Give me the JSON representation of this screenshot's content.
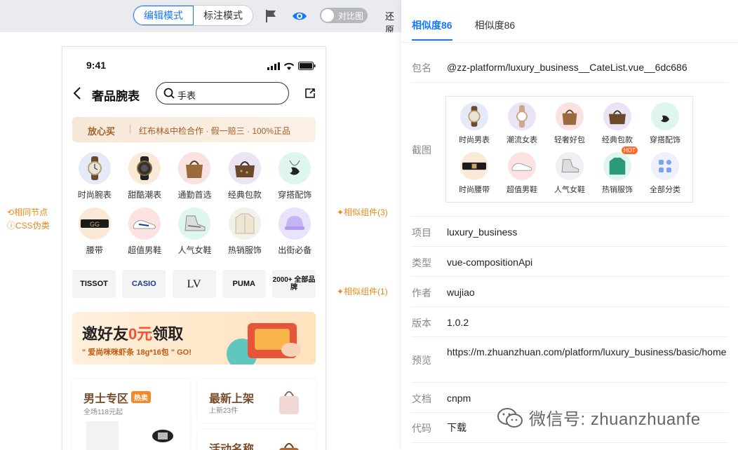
{
  "toolbar": {
    "mode_edit": "编辑模式",
    "mode_annotate": "标注模式",
    "compare_label": "对比图",
    "restore_label": "还原",
    "accent": "#1677ff"
  },
  "canvas": {
    "notes_left": {
      "same_node": "相同节点",
      "css_pseudo": "CSS伪类"
    },
    "notes_right": {
      "similar3": "相似组件(3)",
      "similar1": "相似组件(1)"
    }
  },
  "phone": {
    "time": "9:41",
    "title": "奢品腕表",
    "search_value": "手表",
    "trust": {
      "tag": "放心买",
      "text": "红布林&中检合作 · 假一赔三 · 100%正品"
    },
    "categories": [
      {
        "label": "时尚腕表",
        "icon": "watch-icon"
      },
      {
        "label": "甜酷潮表",
        "icon": "sport-watch-icon"
      },
      {
        "label": "通勤首选",
        "icon": "tote-bag-icon"
      },
      {
        "label": "经典包款",
        "icon": "monogram-bag-icon"
      },
      {
        "label": "穿搭配饰",
        "icon": "swan-necklace-icon"
      },
      {
        "label": "腰带",
        "icon": "belt-icon"
      },
      {
        "label": "超值男鞋",
        "icon": "sneaker-icon"
      },
      {
        "label": "人气女鞋",
        "icon": "high-top-sneaker-icon"
      },
      {
        "label": "热销服饰",
        "icon": "jacket-icon"
      },
      {
        "label": "出街必备",
        "icon": "cap-icon"
      }
    ],
    "brands": [
      "TISSOT",
      "CASIO",
      "LV",
      "PUMA",
      "2000+ 全部品牌"
    ],
    "banner": {
      "prefix": "邀好友",
      "highlight": "0元",
      "suffix": "领取",
      "sub": "\" 爱尚咪咪虾条 18g*16包 \"  GO!"
    },
    "cards": [
      {
        "title": "男士专区",
        "tag": "热卖",
        "sub": "全场118元起"
      },
      {
        "title": "最新上架",
        "sub": "上新23件"
      },
      {
        "title": "活动名称"
      }
    ]
  },
  "panel": {
    "tabs": [
      "相似度86",
      "相似度86"
    ],
    "rows": {
      "package": {
        "k": "包名",
        "v": "@zz-platform/luxury_business__CateList.vue__6dc686"
      },
      "screenshot": {
        "k": "截图"
      },
      "project": {
        "k": "项目",
        "v": "luxury_business"
      },
      "type": {
        "k": "类型",
        "v": "vue-compositionApi"
      },
      "author": {
        "k": "作者",
        "v": "wujiao"
      },
      "version": {
        "k": "版本",
        "v": "1.0.2"
      },
      "preview": {
        "k": "预览",
        "v": "https://m.zhuanzhuan.com/platform/luxury_business/basic/home"
      },
      "docs": {
        "k": "文档",
        "v": "cnpm"
      },
      "code": {
        "k": "代码",
        "v": "下载"
      }
    },
    "shot_items": [
      {
        "label": "时尚男表",
        "icon": "watch-icon"
      },
      {
        "label": "潮流女表",
        "icon": "ladies-watch-icon"
      },
      {
        "label": "轻奢好包",
        "icon": "handbag-icon"
      },
      {
        "label": "经典包款",
        "icon": "monogram-bag-icon"
      },
      {
        "label": "穿搭配饰",
        "icon": "swan-necklace-icon"
      },
      {
        "label": "时尚腰带",
        "icon": "belt-icon"
      },
      {
        "label": "超值男鞋",
        "icon": "sneaker-icon"
      },
      {
        "label": "人气女鞋",
        "icon": "high-top-sneaker-icon"
      },
      {
        "label": "热销服饰",
        "icon": "hoodie-icon",
        "badge": "HOT"
      },
      {
        "label": "全部分类",
        "icon": "grid-icon"
      }
    ]
  },
  "watermark": "微信号: zhuanzhuanfe"
}
